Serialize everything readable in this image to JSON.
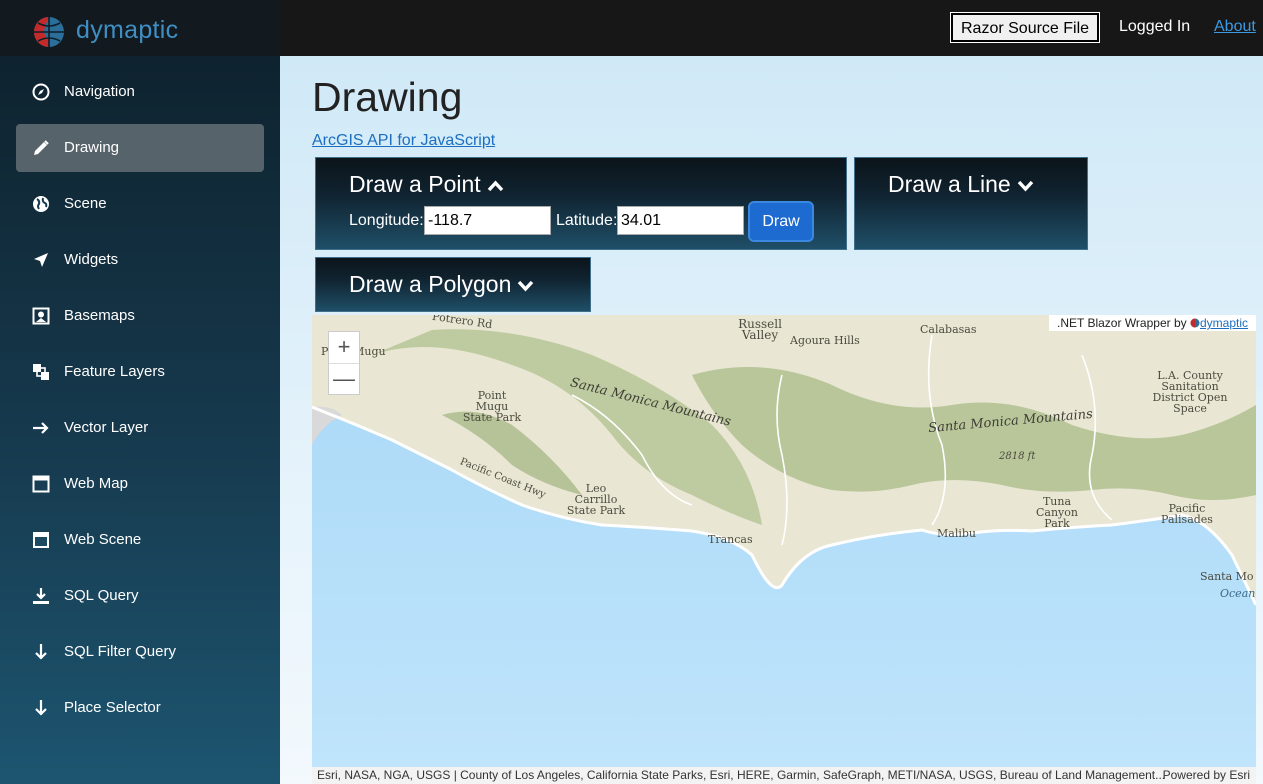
{
  "brand": {
    "name": "dymaptic"
  },
  "topbar": {
    "razor_label": "Razor Source File",
    "logged_in": "Logged In",
    "about": "About"
  },
  "sidebar": {
    "items": [
      {
        "label": "Navigation",
        "icon": "compass-icon",
        "active": false
      },
      {
        "label": "Drawing",
        "icon": "pencil-icon",
        "active": true
      },
      {
        "label": "Scene",
        "icon": "globe-icon",
        "active": false
      },
      {
        "label": "Widgets",
        "icon": "location-arrow-icon",
        "active": false
      },
      {
        "label": "Basemaps",
        "icon": "map-pin-square-icon",
        "active": false
      },
      {
        "label": "Feature Layers",
        "icon": "layers-icon",
        "active": false
      },
      {
        "label": "Vector Layer",
        "icon": "arrow-right-icon",
        "active": false
      },
      {
        "label": "Web Map",
        "icon": "browser-window-icon",
        "active": false
      },
      {
        "label": "Web Scene",
        "icon": "panel-window-icon",
        "active": false
      },
      {
        "label": "SQL Query",
        "icon": "download-icon",
        "active": false
      },
      {
        "label": "SQL Filter Query",
        "icon": "arrow-down-icon",
        "active": false
      },
      {
        "label": "Place Selector",
        "icon": "arrow-down-icon",
        "active": false
      }
    ]
  },
  "main": {
    "title": "Drawing",
    "api_link": "ArcGIS API for JavaScript",
    "point_panel": {
      "title": "Draw a Point",
      "expanded": true,
      "longitude_label": "Longitude:",
      "longitude_value": "-118.7",
      "latitude_label": "Latitude:",
      "latitude_value": "34.01",
      "draw_label": "Draw"
    },
    "line_panel": {
      "title": "Draw a Line",
      "expanded": false
    },
    "polygon_panel": {
      "title": "Draw a Polygon",
      "expanded": false
    }
  },
  "map": {
    "zoom_in": "+",
    "zoom_out": "—",
    "wrapper_text": ".NET Blazor Wrapper by",
    "wrapper_link": "dymaptic",
    "attribution": "Esri, NASA, NGA, USGS | County of Los Angeles, California State Parks, Esri, HERE, Garmin, SafeGraph, METI/NASA, USGS, Bureau of Land Management...",
    "powered_by": "Powered by Esri",
    "labels": {
      "poterro": "Potrero Rd",
      "russell": "Russell Valley",
      "agoura": "Agoura Hills",
      "calabasas": "Calabasas",
      "point_mugu_top": "Point Mugu",
      "point_mugu_park": "Point Mugu State Park",
      "smm_west": "Santa Monica Mountains",
      "smm_east": "Santa Monica Mountains",
      "la_county": "L.A. County Sanitation District Open Space",
      "pch": "Pacific Coast Hwy",
      "elev": "2818 ft",
      "leo": "Leo Carrillo State Park",
      "tuna": "Tuna Canyon Park",
      "pacific_pal": "Pacific Palisades",
      "trancas": "Trancas",
      "malibu": "Malibu",
      "santa_mo": "Santa Mo",
      "ocean": "Ocean"
    }
  },
  "colors": {
    "accent": "#1d6ad0",
    "sidebar_active": "#56636b",
    "water": "#b3defa",
    "land": "#e9e6d3",
    "vegetation": "#b9c799"
  }
}
